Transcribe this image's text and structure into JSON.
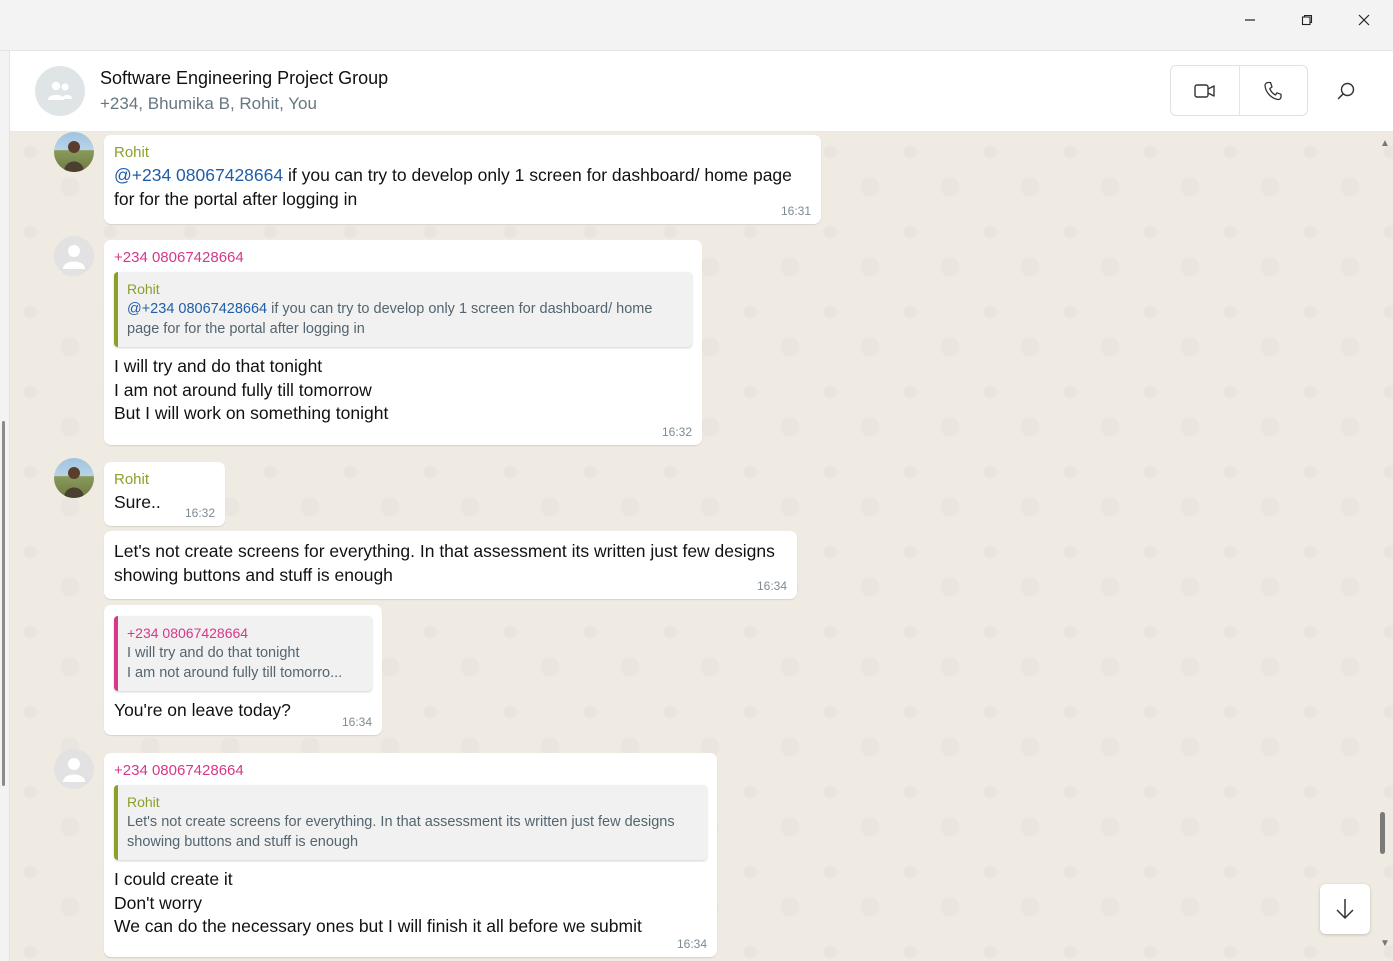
{
  "window": {
    "minimize_icon": "minimize-icon",
    "maximize_icon": "restore-icon",
    "close_icon": "close-icon"
  },
  "header": {
    "title": "Software Engineering Project Group",
    "members": "+234, Bhumika B, Rohit, You",
    "buttons": [
      "video-call-icon",
      "voice-call-icon",
      "search-icon"
    ]
  },
  "colors": {
    "chat_bg": "#efeae2",
    "sender_olive": "#8aa02a",
    "sender_pink": "#d6388a",
    "mention": "#1f5ea8"
  },
  "messages": [
    {
      "sender": "Rohit",
      "mention": "@+234 08067428664",
      "text": " if you can try to develop only 1 screen for dashboard/ home page for  for the portal after logging in",
      "time": "16:31"
    },
    {
      "sender": "+234 08067428664",
      "quote": {
        "name": "Rohit",
        "mention": "@+234 08067428664",
        "text": " if you can try to develop only 1 screen for dashboard/ home page for  for the portal after logging in"
      },
      "lines": [
        "I will try and do that tonight",
        "I am not around fully till tomorrow",
        "But I will work on something tonight"
      ],
      "time": "16:32"
    },
    {
      "sender": "Rohit",
      "text": "Sure..",
      "time": "16:32"
    },
    {
      "text": "Let's not create screens for everything.  In that assessment its written just few designs showing buttons and stuff is enough",
      "time": "16:34"
    },
    {
      "quote": {
        "name": "+234 08067428664",
        "line1": "I will try and do that tonight",
        "line2": "I am not around fully till tomorro..."
      },
      "text": "You're on leave today?",
      "time": "16:34"
    },
    {
      "sender": "+234 08067428664",
      "quote": {
        "name": "Rohit",
        "text": "Let's not create screens for everything.  In that assessment its written just few designs showing buttons and stuff is enough"
      },
      "lines": [
        "I could create it",
        "Don't worry",
        "We can do the necessary ones but I will finish it all before we submit"
      ],
      "time": "16:34"
    }
  ]
}
